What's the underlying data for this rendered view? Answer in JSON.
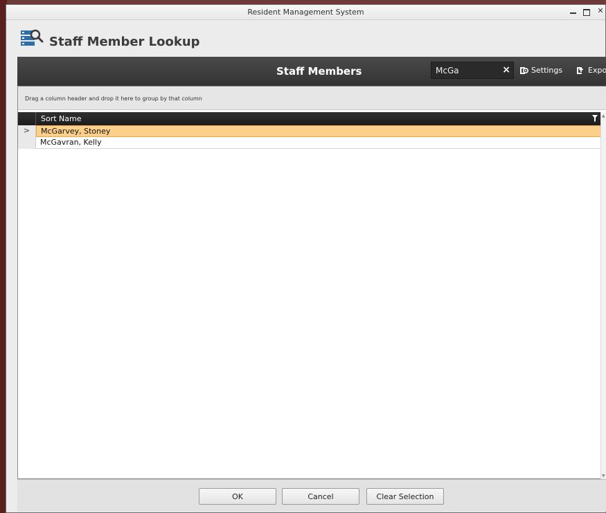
{
  "window": {
    "title": "Resident Management System"
  },
  "header": {
    "title": "Staff Member Lookup",
    "icon": "staff-lookup-icon"
  },
  "toolbar": {
    "title": "Staff Members",
    "search_value": "McGa",
    "clear_icon": "×",
    "settings_label": "Settings",
    "export_label": "Export"
  },
  "grid": {
    "group_hint": "Drag a column header and drop it here to group by that column",
    "column_header": "Sort Name",
    "rows": [
      {
        "indicator": ">",
        "name": "McGarvey, Stoney",
        "selected": true
      },
      {
        "indicator": "",
        "name": "McGavran, Kelly",
        "selected": false
      }
    ]
  },
  "footer": {
    "ok_label": "OK",
    "cancel_label": "Cancel",
    "clear_label": "Clear Selection"
  },
  "colors": {
    "toolbar_bg": "#3a3a3a",
    "selected_row": "#fcd08b",
    "accent_icon": "#2f6fa8"
  }
}
